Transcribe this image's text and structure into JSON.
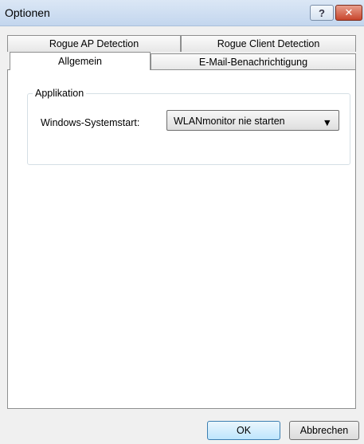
{
  "window": {
    "title": "Optionen",
    "help_label": "?",
    "close_label": "✕"
  },
  "tabs": {
    "row1": [
      {
        "label": "Rogue AP Detection"
      },
      {
        "label": "Rogue Client Detection"
      }
    ],
    "row2": [
      {
        "label": "Allgemein",
        "active": true
      },
      {
        "label": "E-Mail-Benachrichtigung"
      }
    ]
  },
  "group": {
    "legend": "Applikation",
    "field_label": "Windows-Systemstart:",
    "select_value": "WLANmonitor nie starten",
    "select_arrow": "▼"
  },
  "buttons": {
    "ok": "OK",
    "cancel": "Abbrechen"
  }
}
